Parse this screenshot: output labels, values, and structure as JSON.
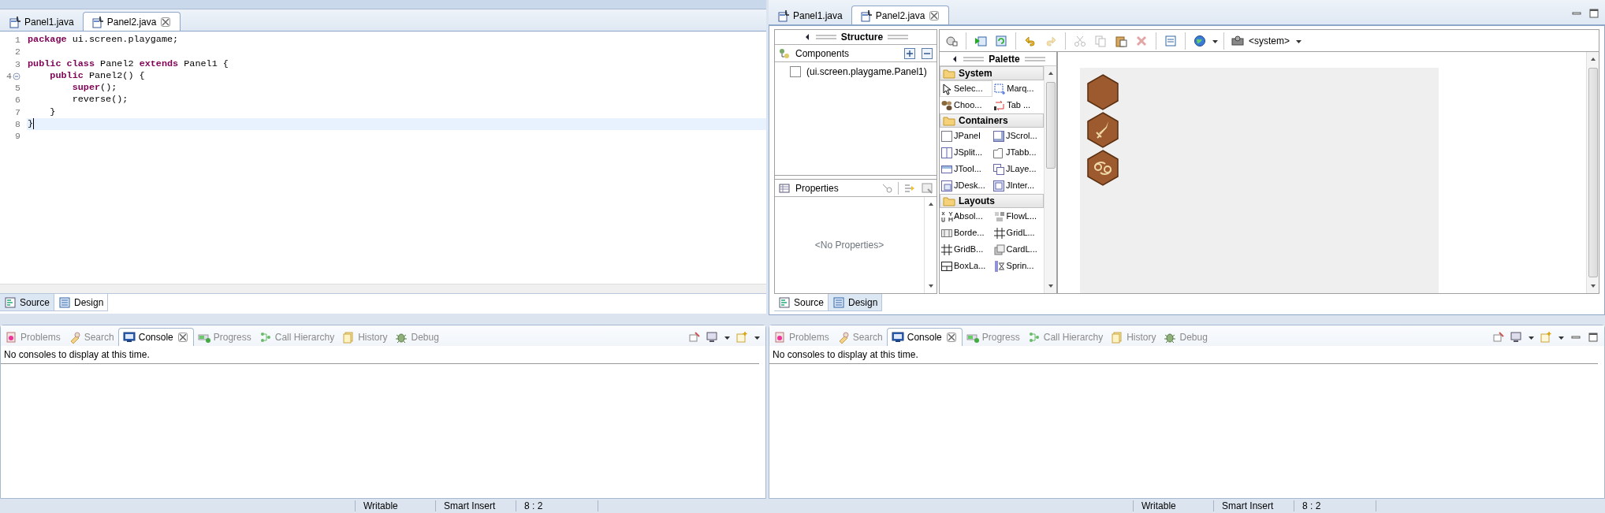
{
  "left_editor": {
    "tabs": [
      {
        "label": "Panel1.java",
        "selected": false
      },
      {
        "label": "Panel2.java",
        "selected": true
      }
    ],
    "lines": [
      {
        "number": "1",
        "code": "**package** ui.screen.playgame;",
        "current": false,
        "fold": false
      },
      {
        "number": "2",
        "current": false,
        "fold": false
      },
      {
        "number": "3",
        "code": "**public** **class** Panel2 **extends** Panel1 {",
        "current": false,
        "fold": false
      },
      {
        "number": "4",
        "code": "    **public** Panel2() {",
        "current": false,
        "fold": true
      },
      {
        "number": "5",
        "code": "        **super**();",
        "current": false,
        "fold": false
      },
      {
        "number": "6",
        "code": "        reverse();",
        "current": false,
        "fold": false
      },
      {
        "number": "7",
        "code": "    }",
        "current": false,
        "fold": false
      },
      {
        "number": "8",
        "code": "}",
        "current": true,
        "fold": false
      },
      {
        "number": "9",
        "current": false,
        "fold": false
      }
    ],
    "mode_tabs": [
      {
        "label": "Source",
        "selected": true
      },
      {
        "label": "Design",
        "selected": false
      }
    ]
  },
  "left_console": {
    "tabs": [
      {
        "label": "Problems",
        "selected": false
      },
      {
        "label": "Search",
        "selected": false
      },
      {
        "label": "Console",
        "selected": true
      },
      {
        "label": "Progress",
        "selected": false
      },
      {
        "label": "Call Hierarchy",
        "selected": false
      },
      {
        "label": "History",
        "selected": false
      },
      {
        "label": "Debug",
        "selected": false
      }
    ],
    "message": "No consoles to display at this time."
  },
  "left_status": [
    "Writable",
    "Smart Insert",
    "8 : 2"
  ],
  "right_editor": {
    "tabs": [
      {
        "label": "Panel1.java",
        "selected": false
      },
      {
        "label": "Panel2.java",
        "selected": true
      }
    ],
    "structure": {
      "title": "Structure",
      "components_title": "Components",
      "components": [
        {
          "label": "(ui.screen.playgame.Panel1)"
        }
      ],
      "properties_title": "Properties",
      "properties_empty": "<No Properties>"
    },
    "toolbar": {
      "buttons": [
        {
          "disabled": false
        },
        {
          "disabled": false
        },
        {
          "disabled": false
        },
        {
          "disabled": false
        },
        {
          "disabled": true
        },
        {
          "disabled": true
        },
        {
          "disabled": true
        },
        {
          "disabled": false
        },
        {
          "disabled": true
        },
        {
          "disabled": false
        },
        {
          "disabled": false
        }
      ],
      "system_label": "<system>"
    },
    "palette": {
      "title": "Palette",
      "groups": [
        {
          "title": "System",
          "items": [
            {
              "label": "Selec...",
              "selected": true
            },
            {
              "label": "Marq...",
              "selected": false
            },
            {
              "label": "Choo...",
              "selected": false
            },
            {
              "label": "Tab ...",
              "selected": false
            }
          ]
        },
        {
          "title": "Containers",
          "items": [
            {
              "label": "JPanel",
              "selected": false
            },
            {
              "label": "JScrol...",
              "selected": false
            },
            {
              "label": "JSplit...",
              "selected": false
            },
            {
              "label": "JTabb...",
              "selected": false
            },
            {
              "label": "JTool...",
              "selected": false
            },
            {
              "label": "JLaye...",
              "selected": false
            },
            {
              "label": "JDesk...",
              "selected": false
            },
            {
              "label": "JInter...",
              "selected": false
            }
          ]
        },
        {
          "title": "Layouts",
          "items": [
            {
              "label": "Absol...",
              "selected": false
            },
            {
              "label": "FlowL...",
              "selected": false
            },
            {
              "label": "Borde...",
              "selected": false
            },
            {
              "label": "GridL...",
              "selected": false
            },
            {
              "label": "GridB...",
              "selected": false
            },
            {
              "label": "CardL...",
              "selected": false
            },
            {
              "label": "BoxLa...",
              "selected": false
            },
            {
              "label": "Sprin...",
              "selected": false
            }
          ]
        }
      ]
    },
    "mode_tabs": [
      {
        "label": "Source",
        "selected": false
      },
      {
        "label": "Design",
        "selected": true
      }
    ]
  },
  "right_console": {
    "tabs": [
      {
        "label": "Problems",
        "selected": false
      },
      {
        "label": "Search",
        "selected": false
      },
      {
        "label": "Console",
        "selected": true
      },
      {
        "label": "Progress",
        "selected": false
      },
      {
        "label": "Call Hierarchy",
        "selected": false
      },
      {
        "label": "History",
        "selected": false
      },
      {
        "label": "Debug",
        "selected": false
      }
    ],
    "message": "No consoles to display at this time."
  },
  "right_status": [
    "Writable",
    "Smart Insert",
    "8 : 2"
  ]
}
